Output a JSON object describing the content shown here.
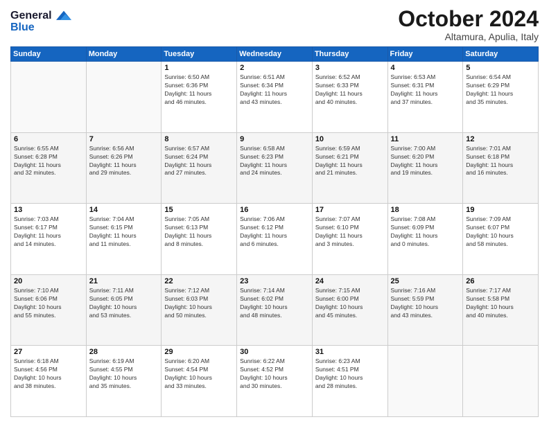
{
  "logo": {
    "line1": "General",
    "line2": "Blue"
  },
  "title": "October 2024",
  "subtitle": "Altamura, Apulia, Italy",
  "weekdays": [
    "Sunday",
    "Monday",
    "Tuesday",
    "Wednesday",
    "Thursday",
    "Friday",
    "Saturday"
  ],
  "weeks": [
    [
      {
        "day": "",
        "info": ""
      },
      {
        "day": "",
        "info": ""
      },
      {
        "day": "1",
        "info": "Sunrise: 6:50 AM\nSunset: 6:36 PM\nDaylight: 11 hours\nand 46 minutes."
      },
      {
        "day": "2",
        "info": "Sunrise: 6:51 AM\nSunset: 6:34 PM\nDaylight: 11 hours\nand 43 minutes."
      },
      {
        "day": "3",
        "info": "Sunrise: 6:52 AM\nSunset: 6:33 PM\nDaylight: 11 hours\nand 40 minutes."
      },
      {
        "day": "4",
        "info": "Sunrise: 6:53 AM\nSunset: 6:31 PM\nDaylight: 11 hours\nand 37 minutes."
      },
      {
        "day": "5",
        "info": "Sunrise: 6:54 AM\nSunset: 6:29 PM\nDaylight: 11 hours\nand 35 minutes."
      }
    ],
    [
      {
        "day": "6",
        "info": "Sunrise: 6:55 AM\nSunset: 6:28 PM\nDaylight: 11 hours\nand 32 minutes."
      },
      {
        "day": "7",
        "info": "Sunrise: 6:56 AM\nSunset: 6:26 PM\nDaylight: 11 hours\nand 29 minutes."
      },
      {
        "day": "8",
        "info": "Sunrise: 6:57 AM\nSunset: 6:24 PM\nDaylight: 11 hours\nand 27 minutes."
      },
      {
        "day": "9",
        "info": "Sunrise: 6:58 AM\nSunset: 6:23 PM\nDaylight: 11 hours\nand 24 minutes."
      },
      {
        "day": "10",
        "info": "Sunrise: 6:59 AM\nSunset: 6:21 PM\nDaylight: 11 hours\nand 21 minutes."
      },
      {
        "day": "11",
        "info": "Sunrise: 7:00 AM\nSunset: 6:20 PM\nDaylight: 11 hours\nand 19 minutes."
      },
      {
        "day": "12",
        "info": "Sunrise: 7:01 AM\nSunset: 6:18 PM\nDaylight: 11 hours\nand 16 minutes."
      }
    ],
    [
      {
        "day": "13",
        "info": "Sunrise: 7:03 AM\nSunset: 6:17 PM\nDaylight: 11 hours\nand 14 minutes."
      },
      {
        "day": "14",
        "info": "Sunrise: 7:04 AM\nSunset: 6:15 PM\nDaylight: 11 hours\nand 11 minutes."
      },
      {
        "day": "15",
        "info": "Sunrise: 7:05 AM\nSunset: 6:13 PM\nDaylight: 11 hours\nand 8 minutes."
      },
      {
        "day": "16",
        "info": "Sunrise: 7:06 AM\nSunset: 6:12 PM\nDaylight: 11 hours\nand 6 minutes."
      },
      {
        "day": "17",
        "info": "Sunrise: 7:07 AM\nSunset: 6:10 PM\nDaylight: 11 hours\nand 3 minutes."
      },
      {
        "day": "18",
        "info": "Sunrise: 7:08 AM\nSunset: 6:09 PM\nDaylight: 11 hours\nand 0 minutes."
      },
      {
        "day": "19",
        "info": "Sunrise: 7:09 AM\nSunset: 6:07 PM\nDaylight: 10 hours\nand 58 minutes."
      }
    ],
    [
      {
        "day": "20",
        "info": "Sunrise: 7:10 AM\nSunset: 6:06 PM\nDaylight: 10 hours\nand 55 minutes."
      },
      {
        "day": "21",
        "info": "Sunrise: 7:11 AM\nSunset: 6:05 PM\nDaylight: 10 hours\nand 53 minutes."
      },
      {
        "day": "22",
        "info": "Sunrise: 7:12 AM\nSunset: 6:03 PM\nDaylight: 10 hours\nand 50 minutes."
      },
      {
        "day": "23",
        "info": "Sunrise: 7:14 AM\nSunset: 6:02 PM\nDaylight: 10 hours\nand 48 minutes."
      },
      {
        "day": "24",
        "info": "Sunrise: 7:15 AM\nSunset: 6:00 PM\nDaylight: 10 hours\nand 45 minutes."
      },
      {
        "day": "25",
        "info": "Sunrise: 7:16 AM\nSunset: 5:59 PM\nDaylight: 10 hours\nand 43 minutes."
      },
      {
        "day": "26",
        "info": "Sunrise: 7:17 AM\nSunset: 5:58 PM\nDaylight: 10 hours\nand 40 minutes."
      }
    ],
    [
      {
        "day": "27",
        "info": "Sunrise: 6:18 AM\nSunset: 4:56 PM\nDaylight: 10 hours\nand 38 minutes."
      },
      {
        "day": "28",
        "info": "Sunrise: 6:19 AM\nSunset: 4:55 PM\nDaylight: 10 hours\nand 35 minutes."
      },
      {
        "day": "29",
        "info": "Sunrise: 6:20 AM\nSunset: 4:54 PM\nDaylight: 10 hours\nand 33 minutes."
      },
      {
        "day": "30",
        "info": "Sunrise: 6:22 AM\nSunset: 4:52 PM\nDaylight: 10 hours\nand 30 minutes."
      },
      {
        "day": "31",
        "info": "Sunrise: 6:23 AM\nSunset: 4:51 PM\nDaylight: 10 hours\nand 28 minutes."
      },
      {
        "day": "",
        "info": ""
      },
      {
        "day": "",
        "info": ""
      }
    ]
  ]
}
